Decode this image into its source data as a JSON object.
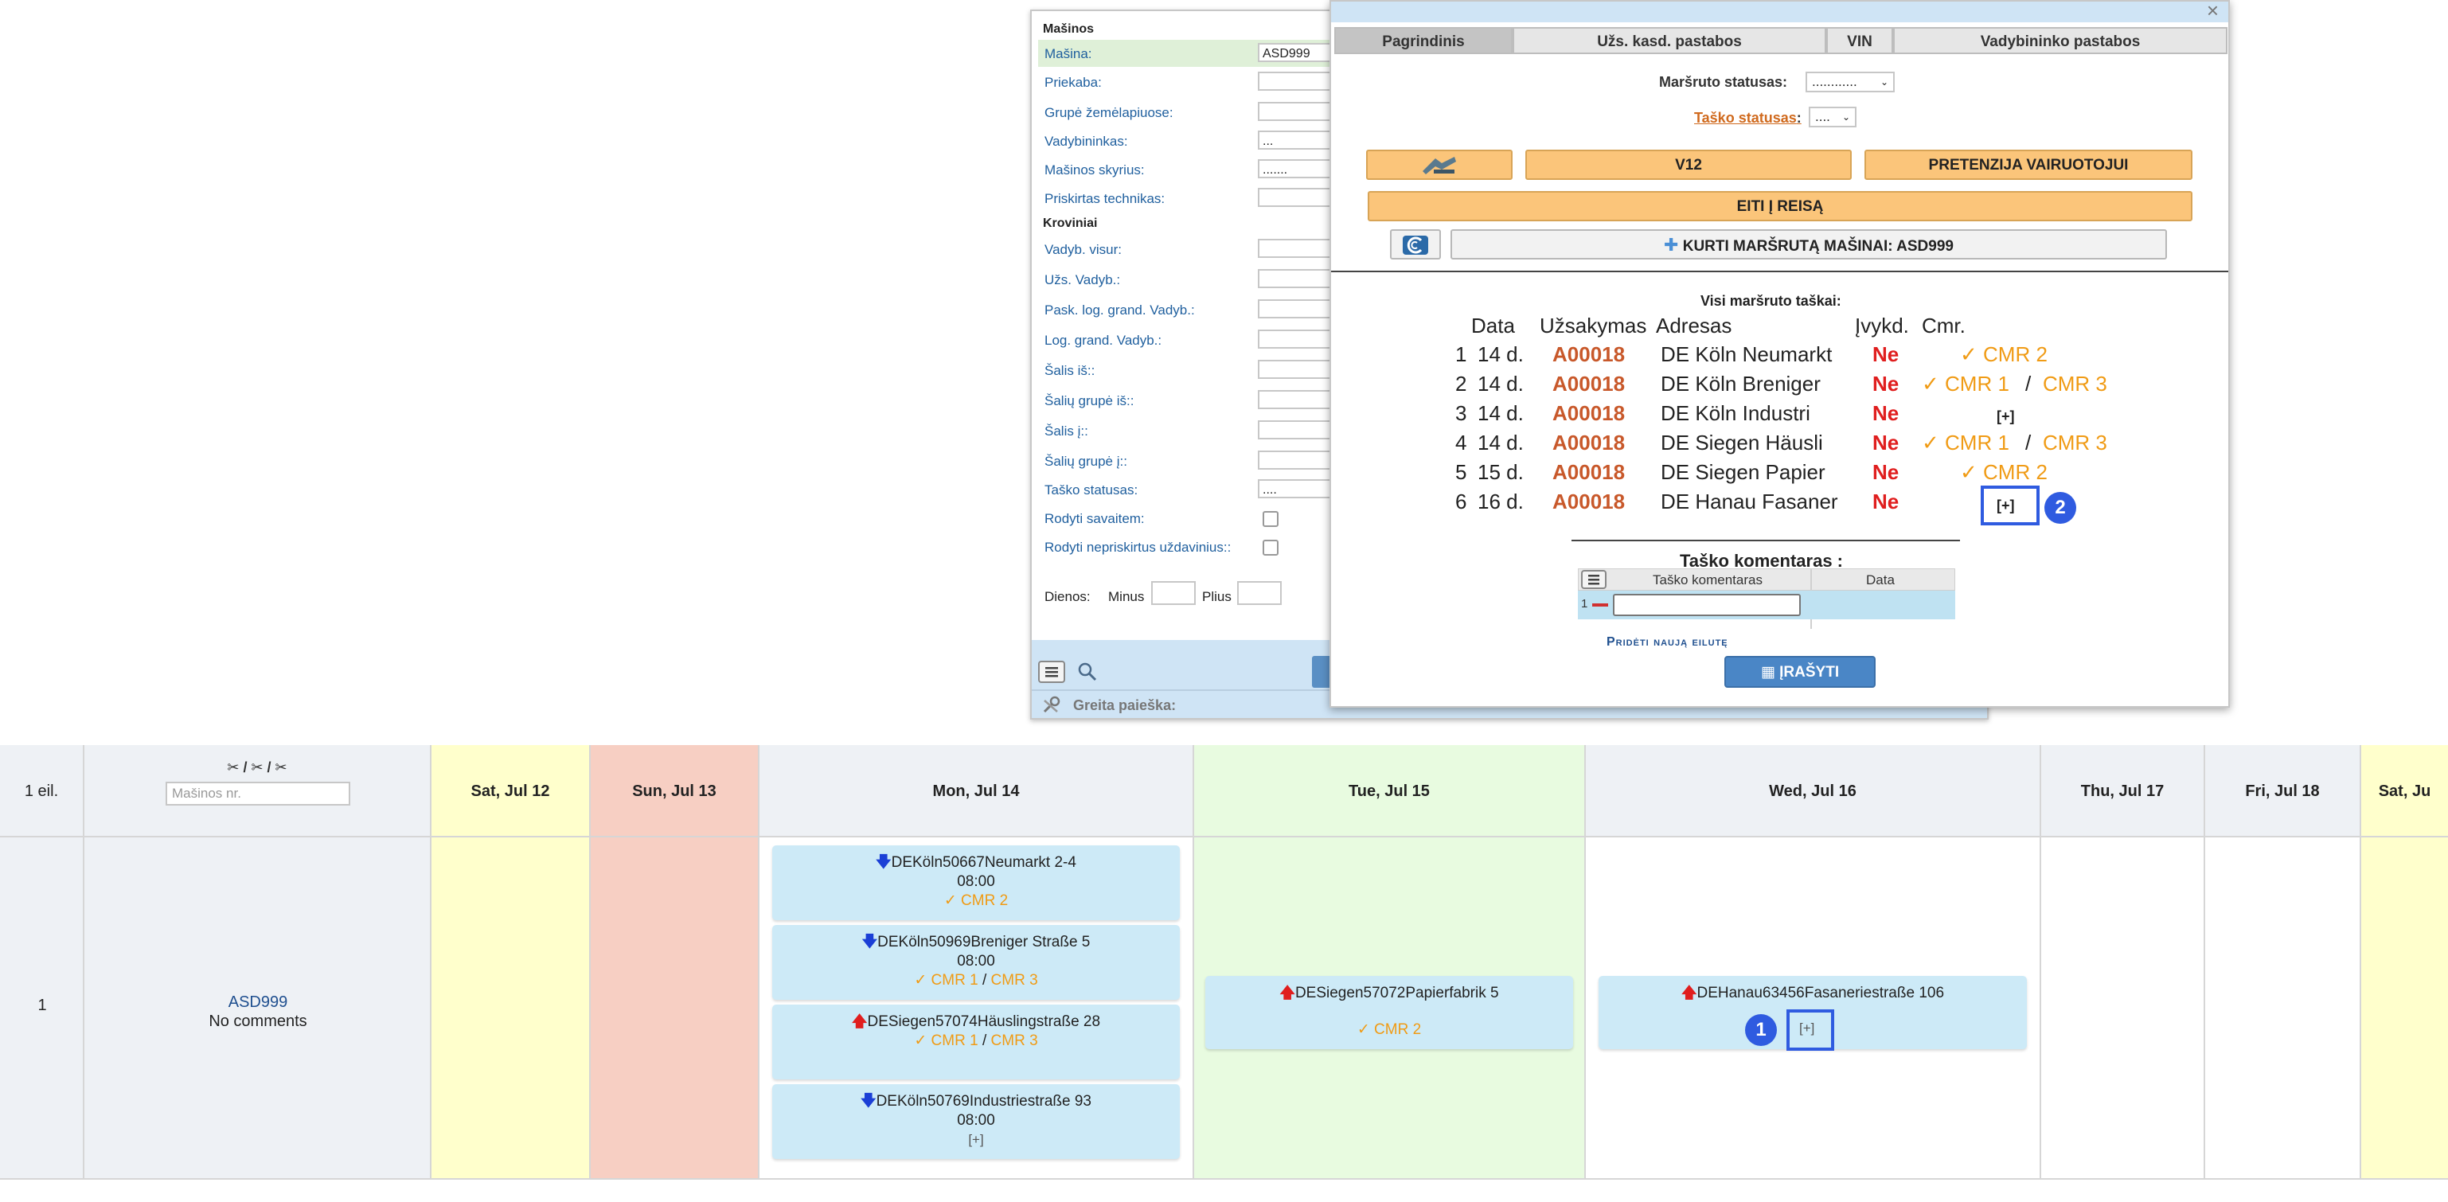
{
  "filter_panel": {
    "section_masinos": "Mašinos",
    "rows1": [
      {
        "label": "Mašina:",
        "value": "ASD999"
      },
      {
        "label": "Priekaba:",
        "value": ""
      },
      {
        "label": "Grupė žemėlapiuose:",
        "value": ""
      },
      {
        "label": "Vadybininkas:",
        "value": "..."
      },
      {
        "label": "Mašinos skyrius:",
        "value": "......."
      },
      {
        "label": "Priskirtas technikas:",
        "value": ""
      }
    ],
    "section_kroviniai": "Kroviniai",
    "rows2": [
      {
        "label": "Vadyb. visur:",
        "value": ""
      },
      {
        "label": "Užs. Vadyb.:",
        "value": ""
      },
      {
        "label": "Pask. log. grand. Vadyb.:",
        "value": ""
      },
      {
        "label": "Log. grand. Vadyb.:",
        "value": ""
      },
      {
        "label": "Šalis iš::",
        "value": ""
      },
      {
        "label": "Šalių grupė iš::",
        "value": ""
      },
      {
        "label": "Šalis į::",
        "value": ""
      },
      {
        "label": "Šalių grupė į::",
        "value": ""
      },
      {
        "label": "Taško statusas:",
        "value": "...."
      }
    ],
    "check_rows": [
      {
        "label": "Rodyti savaitem:"
      },
      {
        "label": "Rodyti nepriskirtus uždavinius::"
      }
    ],
    "dienos_label": "Dienos:",
    "minus_label": "Minus",
    "plius_label": "Plius",
    "quick_search_label": "Greita paieška:"
  },
  "route_dialog": {
    "tabs": [
      "Pagrindinis",
      "Užs. kasd. pastabos",
      "VIN",
      "Vadybininko pastabos"
    ],
    "route_status_label": "Maršruto statusas:",
    "route_status_value": "............",
    "point_status_label": "Taško statusas",
    "point_status_value": "....",
    "btn_v12": "V12",
    "btn_claim": "PRETENZIJA VAIRUOTOJUI",
    "btn_go_trip": "EITI Į REISĄ",
    "btn_create_route": "KURTI MARŠRUTĄ MAŠINAI: ASD999",
    "route_points_title": "Visi maršruto taškai:",
    "headers": {
      "date": "Data",
      "order": "Užsakymas",
      "address": "Adresas",
      "done": "Įvykd.",
      "cmr": "Cmr."
    },
    "points": [
      {
        "n": "1",
        "date": "14 d.",
        "order": "A00018",
        "address": "DE Köln Neumarkt",
        "done": "Ne",
        "cmr": [
          "✓ CMR 2"
        ]
      },
      {
        "n": "2",
        "date": "14 d.",
        "order": "A00018",
        "address": "DE Köln Breniger",
        "done": "Ne",
        "cmr": [
          "✓ CMR 1",
          "CMR 3"
        ]
      },
      {
        "n": "3",
        "date": "14 d.",
        "order": "A00018",
        "address": "DE Köln Industri",
        "done": "Ne",
        "cmr": [
          "[+]"
        ]
      },
      {
        "n": "4",
        "date": "14 d.",
        "order": "A00018",
        "address": "DE Siegen Häusli",
        "done": "Ne",
        "cmr": [
          "✓ CMR 1",
          "CMR 3"
        ]
      },
      {
        "n": "5",
        "date": "15 d.",
        "order": "A00018",
        "address": "DE Siegen Papier",
        "done": "Ne",
        "cmr": [
          "✓ CMR 2"
        ]
      },
      {
        "n": "6",
        "date": "16 d.",
        "order": "A00018",
        "address": "DE Hanau Fasaner",
        "done": "Ne",
        "cmr": [
          "[+]"
        ]
      }
    ],
    "badge2": "2",
    "comment_title": "Taško komentaras :",
    "comment_headers": {
      "comment": "Taško komentaras",
      "date": "Data"
    },
    "comment_row_index": "1",
    "add_row_link": "Pridėti naują eilutę",
    "save_button": "ĮRAŠYTI"
  },
  "calendar": {
    "row_count_label": "1 eil.",
    "vehicle_search_placeholder": "Mašinos nr.",
    "days": [
      "Sat, Jul 12",
      "Sun, Jul 13",
      "Mon, Jul 14",
      "Tue, Jul 15",
      "Wed, Jul 16",
      "Thu, Jul 17",
      "Fri, Jul 18",
      "Sat, Ju"
    ],
    "row_number": "1",
    "vehicle": "ASD999",
    "vehicle_comment": "No comments",
    "mon_cards": [
      {
        "direction": "down",
        "address": "DEKöln50667Neumarkt 2-4",
        "time": "08:00",
        "cmr": [
          "✓ CMR 2"
        ]
      },
      {
        "direction": "down",
        "address": "DEKöln50969Breniger Straße 5",
        "time": "08:00",
        "cmr": [
          "✓ CMR 1",
          "CMR 3"
        ]
      },
      {
        "direction": "up",
        "address": "DESiegen57074Häuslingstraße 28",
        "time": "",
        "cmr": [
          "✓ CMR 1",
          "CMR 3"
        ]
      },
      {
        "direction": "down",
        "address": "DEKöln50769Industriestraße 93",
        "time": "08:00",
        "cmr": [
          "[+]"
        ]
      }
    ],
    "tue_card": {
      "direction": "up",
      "address": "DESiegen57072Papierfabrik 5",
      "cmr": "✓ CMR 2"
    },
    "wed_card": {
      "direction": "up",
      "address": "DEHanau63456Fasaneriestraße 106",
      "plus": "[+]"
    },
    "badge1": "1",
    "colors": {
      "sat": "#ffffcc",
      "sun": "#f7cfc3",
      "tue": "#e8fbe0",
      "card": "#cdeaf7",
      "highlight": "#2f5be0"
    }
  }
}
